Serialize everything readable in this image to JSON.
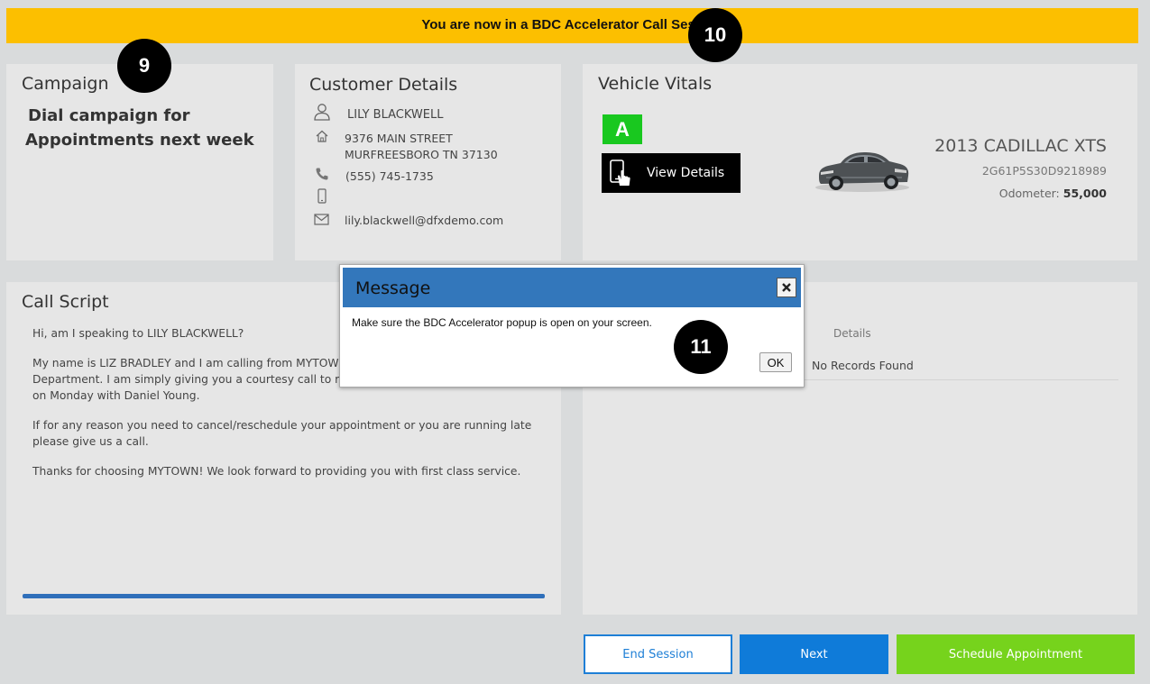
{
  "banner": {
    "text": "You are now in a BDC Accelerator Call Session"
  },
  "callouts": {
    "c9": "9",
    "c10": "10",
    "c11": "11"
  },
  "campaign": {
    "title": "Campaign",
    "name_line1": "Dial campaign for",
    "name_line2": "Appointments next week"
  },
  "customer": {
    "title": "Customer Details",
    "name": "LILY BLACKWELL",
    "street": "9376 MAIN STREET",
    "city": "MURFREESBORO TN 37130",
    "phone": "(555) 745-1735",
    "mobile": "",
    "email": "lily.blackwell@dfxdemo.com",
    "icons": [
      "person-icon",
      "home-icon",
      "phone-icon",
      "mobile-icon",
      "email-icon"
    ]
  },
  "vehicle": {
    "title": "Vehicle Vitals",
    "grade": "A",
    "view_details": "View Details",
    "name": "2013 CADILLAC XTS",
    "vin": "2G61P5S30D9218989",
    "odometer_label": "Odometer:",
    "odometer_value": "55,000"
  },
  "script": {
    "title": "Call Script",
    "p1": "Hi, am I speaking to  LILY BLACKWELL?",
    "p2_line1": "My name is LIZ BRADLEY and I am calling from MYTOWN",
    "p2_line2": "Department.  I am simply giving you a courtesy call to rem",
    "p2_line3": "on Monday with Daniel Young.",
    "p3_line1": "If for any reason you need to cancel/reschedule your appointment or you are running late",
    "p3_line2": "please give us a call.",
    "p4": "Thanks for choosing MYTOWN! We look forward to providing you with first class service."
  },
  "records": {
    "header": "Details",
    "empty": "No Records Found"
  },
  "footer": {
    "end_session": "End Session",
    "next": "Next",
    "schedule": "Schedule Appointment"
  },
  "dialog": {
    "title": "Message",
    "message": "Make sure the BDC Accelerator popup is open on your screen.",
    "ok": "OK"
  },
  "colors": {
    "banner": "#fcbf00",
    "grade": "#19c81f",
    "next": "#0f7bd9",
    "schedule": "#76d31c",
    "dialog_header": "#3377bb"
  }
}
